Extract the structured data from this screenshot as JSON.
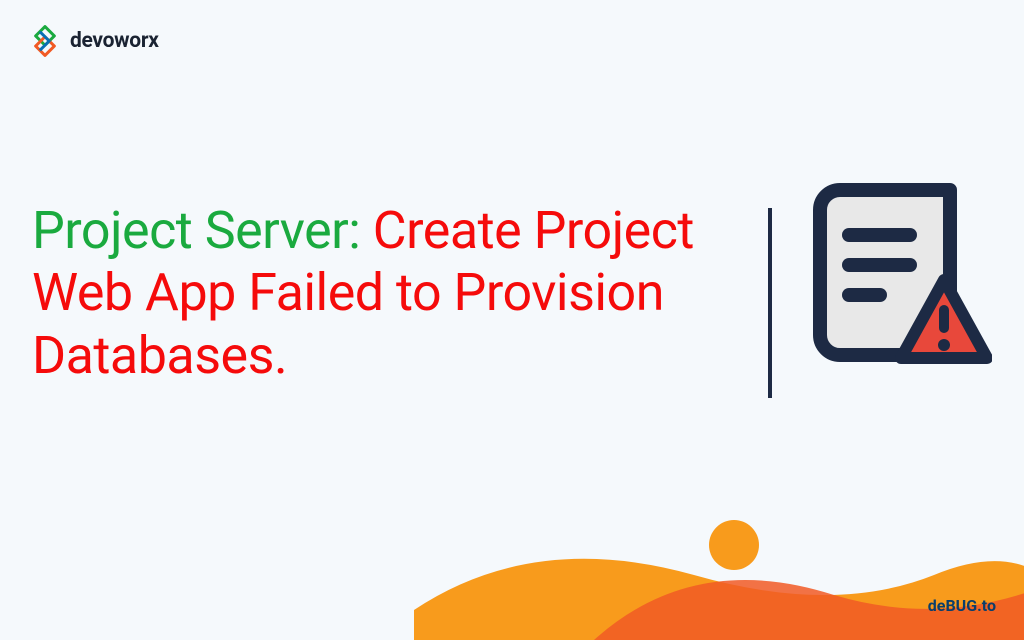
{
  "logo": {
    "text": "devoworx"
  },
  "title": {
    "part1": "Project Server: ",
    "part2": "Create Project Web App Failed to Provision Databases."
  },
  "footer": {
    "brand": "deBUG.to"
  },
  "colors": {
    "green": "#1aaa3f",
    "red": "#f50b0b",
    "navy": "#1d2a44",
    "orange": "#f89b1c",
    "darkOrange": "#f15a24",
    "errorRed": "#e8483b"
  }
}
